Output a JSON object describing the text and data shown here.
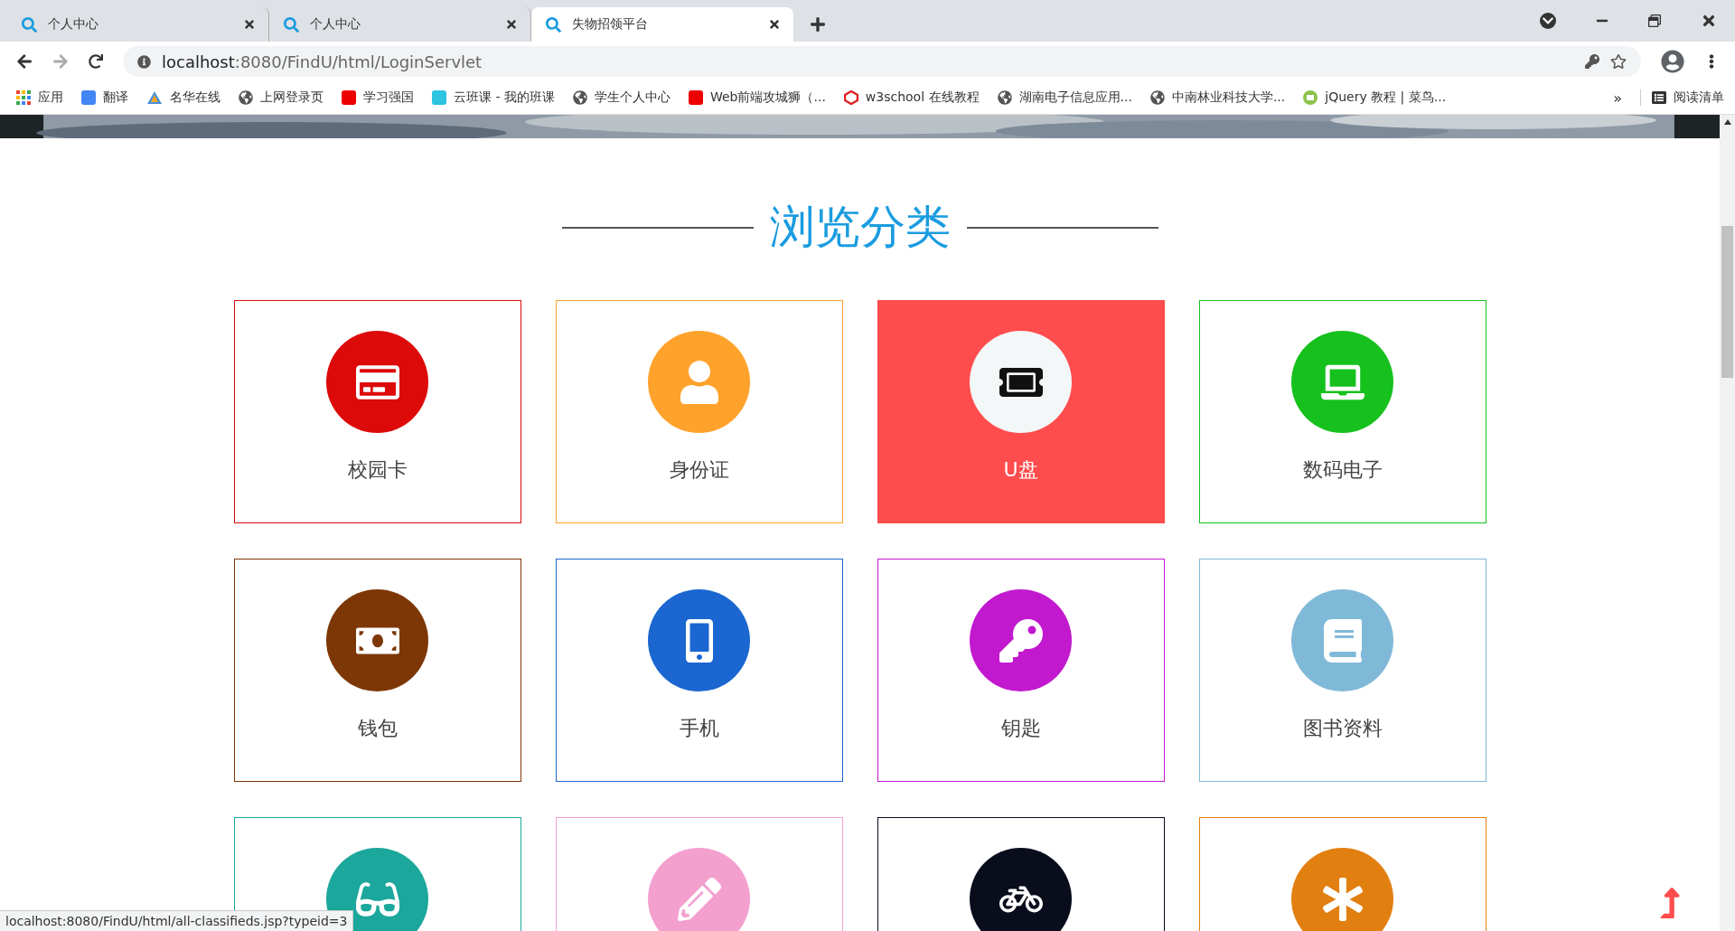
{
  "tabs": [
    {
      "title": "个人中心",
      "selected": false
    },
    {
      "title": "个人中心",
      "selected": false
    },
    {
      "title": "失物招领平台",
      "selected": true
    }
  ],
  "address_bar": {
    "host": "localhost",
    "path": ":8080/FindU/html/LoginServlet"
  },
  "bookmarks": [
    {
      "kind": "apps",
      "label": "应用"
    },
    {
      "kind": "translate",
      "label": "翻译"
    },
    {
      "kind": "logo",
      "label": "名华在线"
    },
    {
      "kind": "globe",
      "label": "上网登录页"
    },
    {
      "kind": "red",
      "label": "学习强国"
    },
    {
      "kind": "cloud",
      "label": "云班课 - 我的班课"
    },
    {
      "kind": "globe",
      "label": "学生个人中心"
    },
    {
      "kind": "red",
      "label": "Web前端攻城狮（..."
    },
    {
      "kind": "w3",
      "label": "w3school 在线教程"
    },
    {
      "kind": "globe",
      "label": "湖南电子信息应用..."
    },
    {
      "kind": "globe",
      "label": "中南林业科技大学..."
    },
    {
      "kind": "code",
      "label": "jQuery 教程 | 菜鸟..."
    }
  ],
  "bookmarks_more": "»",
  "reading_list": "阅读清单",
  "section_title": "浏览分类",
  "categories": [
    {
      "label": "校园卡",
      "color": "#dd0a0a",
      "selected": false
    },
    {
      "label": "身份证",
      "color": "#ffa22b",
      "selected": false
    },
    {
      "label": "U盘",
      "color": "#ff4d4d",
      "selected": true
    },
    {
      "label": "数码电子",
      "color": "#16c11d",
      "selected": false
    },
    {
      "label": "钱包",
      "color": "#7d3706",
      "selected": false
    },
    {
      "label": "手机",
      "color": "#1b66d0",
      "selected": false
    },
    {
      "label": "钥匙",
      "color": "#c219cf",
      "selected": false
    },
    {
      "label": "图书资料",
      "color": "#80b9d8",
      "selected": false
    },
    {
      "color": "#1ca79c",
      "selected": false
    },
    {
      "color": "#f3a0cf",
      "selected": false
    },
    {
      "color": "#0a0d1c",
      "selected": false
    },
    {
      "color": "#e27f11",
      "selected": false
    }
  ],
  "status_bar": "localhost:8080/FindU/html/all-classifieds.jsp?typeid=3"
}
